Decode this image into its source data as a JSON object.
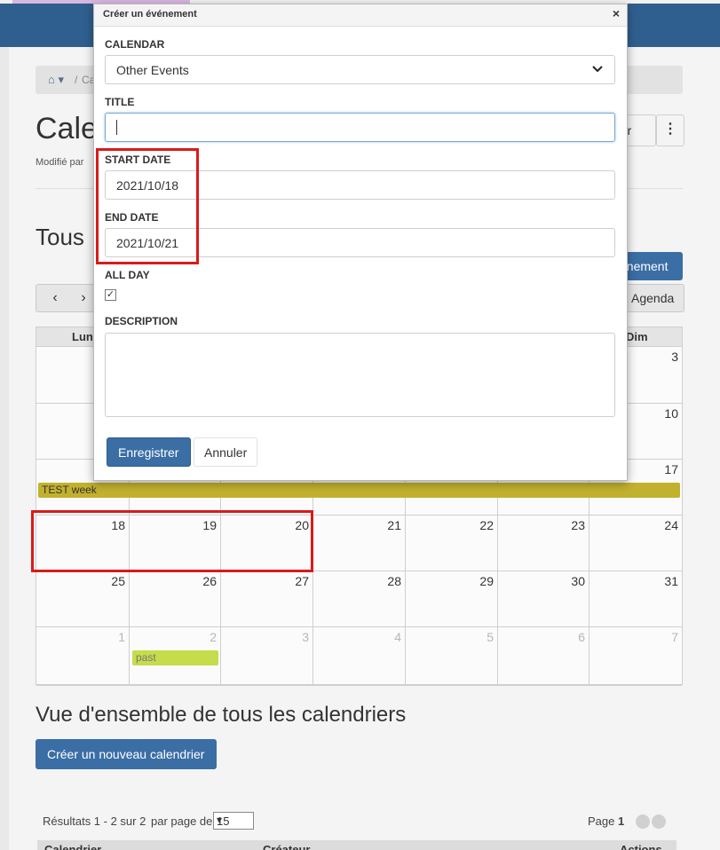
{
  "breadcrumb": {
    "separator": "/",
    "current": "Ca"
  },
  "page": {
    "title": "Cale",
    "modified": "Modifié par",
    "section_title": "Tous"
  },
  "toolbar": {
    "create_partial": "éer",
    "kebab": "⋮",
    "new_event_partial": "énement",
    "prev": "‹",
    "next": "›",
    "agenda": "Agenda"
  },
  "calendar": {
    "headers": {
      "first": "Lun",
      "last": "Dim"
    },
    "weeks": [
      {
        "days": [
          "",
          "",
          "",
          "",
          "",
          "",
          "3"
        ]
      },
      {
        "days": [
          "",
          "",
          "",
          "",
          "",
          "",
          "10"
        ]
      },
      {
        "days": [
          "",
          "",
          "",
          "",
          "",
          "",
          "17"
        ]
      },
      {
        "days": [
          "18",
          "19",
          "20",
          "21",
          "22",
          "23",
          "24"
        ]
      },
      {
        "days": [
          "25",
          "26",
          "27",
          "28",
          "29",
          "30",
          "31"
        ]
      },
      {
        "days": [
          "1",
          "2",
          "3",
          "4",
          "5",
          "6",
          "7"
        ]
      }
    ],
    "events": {
      "week": "TEST week",
      "past": "past"
    }
  },
  "overview": {
    "title": "Vue d'ensemble de tous les calendriers",
    "create_button": "Créer un nouveau calendrier"
  },
  "results": {
    "summary": "Résultats 1 - 2 sur 2",
    "per_page_label": "par page de",
    "per_page_value": "15",
    "page_label": "Page",
    "page_number": "1"
  },
  "table": {
    "col_calendar": "Calendrier",
    "col_creator": "Créateur",
    "col_actions": "Actions"
  },
  "modal": {
    "title": "Créer un événement",
    "close": "×",
    "calendar_label": "CALENDAR",
    "calendar_value": "Other Events",
    "title_label": "TITLE",
    "title_value": "",
    "start_label": "START DATE",
    "start_value": "2021/10/18",
    "end_label": "END DATE",
    "end_value": "2021/10/21",
    "allday_label": "ALL DAY",
    "allday_checked": "✓",
    "description_label": "DESCRIPTION",
    "save_label": "Enregistrer",
    "cancel_label": "Annuler"
  },
  "colors": {
    "navbar": "#2f5f8e",
    "primary": "#3b6ea5",
    "event_week": "#c2b12e",
    "event_past": "#c7dc4b",
    "highlight": "#d81b1b"
  }
}
